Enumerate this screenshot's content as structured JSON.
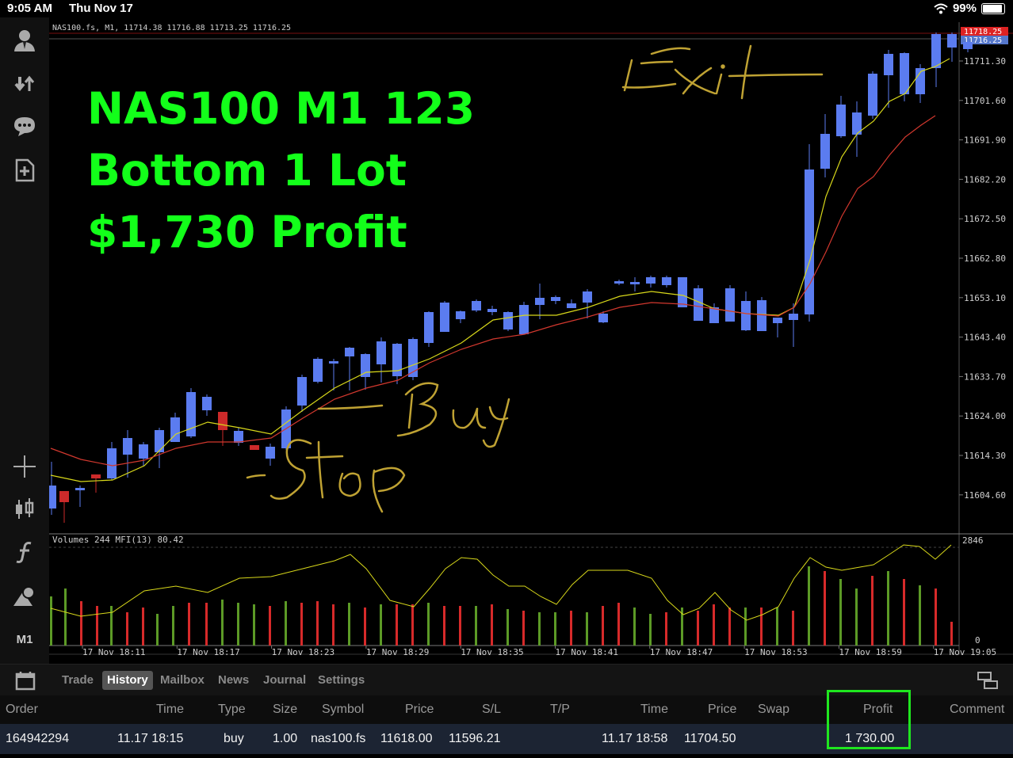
{
  "status_bar": {
    "time": "9:05 AM",
    "date": "Thu Nov 17",
    "battery": "99%"
  },
  "sidebar": {
    "top_icons": [
      "user-icon",
      "download-upload-icon",
      "chat-icon",
      "new-order-icon"
    ],
    "bottom_icons": [
      "crosshair-icon",
      "candles-icon",
      "function-icon",
      "objects-icon"
    ],
    "timeframe_label": "M1"
  },
  "chart": {
    "header": "NAS100.fs, M1, 11714.38 11716.88 11713.25 11716.25",
    "price_labels": [
      "11711.30",
      "11701.60",
      "11691.90",
      "11682.20",
      "11672.50",
      "11662.80",
      "11653.10",
      "11643.40",
      "11633.70",
      "11624.00",
      "11614.30",
      "11604.60"
    ],
    "tag_ask": "11718.25",
    "tag_bid": "11716.25",
    "volume_header": "Volumes 244 MFI(13) 80.42",
    "volume_max": "2846",
    "volume_min": "0",
    "time_labels": [
      "17 Nov 18:11",
      "17 Nov 18:17",
      "17 Nov 18:23",
      "17 Nov 18:29",
      "17 Nov 18:35",
      "17 Nov 18:41",
      "17 Nov 18:47",
      "17 Nov 18:53",
      "17 Nov 18:59",
      "17 Nov 19:05"
    ],
    "annotations": {
      "exit": "Exit",
      "buy": "Buy",
      "stop": "Stop"
    },
    "colors": {
      "bull": "#5b7cf0",
      "bear": "#cc2a2a",
      "fast_ma": "#d8d81a",
      "slow_ma": "#d2382e",
      "vol_up": "#5c9a26",
      "vol_down": "#d72a2a",
      "handwriting": "#bfa233"
    }
  },
  "overlay": {
    "line1": "NAS100 M1 123",
    "line2": "Bottom 1 Lot",
    "line3": "$1,730 Profit",
    "color": "#13ff1a"
  },
  "tabs": [
    "Trade",
    "History",
    "Mailbox",
    "News",
    "Journal",
    "Settings"
  ],
  "active_tab": "History",
  "table": {
    "headers": {
      "order": "Order",
      "time_open": "Time",
      "type": "Type",
      "size": "Size",
      "symbol": "Symbol",
      "price_open": "Price",
      "sl": "S/L",
      "tp": "T/P",
      "time_close": "Time",
      "price_close": "Price",
      "swap": "Swap",
      "profit": "Profit",
      "comment": "Comment"
    },
    "row": {
      "order": "164942294",
      "time_open": "11.17 18:15",
      "type": "buy",
      "size": "1.00",
      "symbol": "nas100.fs",
      "price_open": "11618.00",
      "sl": "11596.21",
      "tp": "",
      "time_close": "11.17 18:58",
      "price_close": "11704.50",
      "swap": "",
      "profit": "1 730.00",
      "comment": ""
    },
    "highlight_color": "#1fe61f"
  }
}
